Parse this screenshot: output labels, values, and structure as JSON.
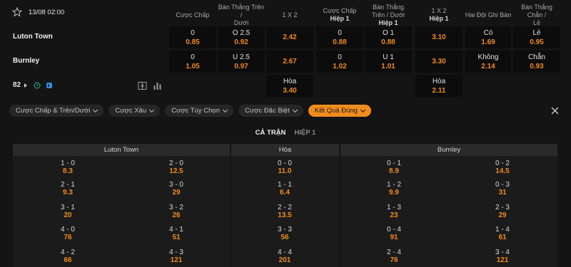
{
  "match": {
    "datetime": "13/08 02:00",
    "home_team": "Luton Town",
    "away_team": "Burnley",
    "more_markets_count": "82"
  },
  "columns": [
    {
      "line1": "Cược Chấp",
      "line2": ""
    },
    {
      "line1": "Bàn Thắng Trên /",
      "line2": "Dưới"
    },
    {
      "line1": "1 X 2",
      "line2": ""
    },
    {
      "line1": "Cược Chấp",
      "line2": "Hiệp 1"
    },
    {
      "line1": "Bàn Thắng Trên / Dưới",
      "line2": "Hiệp 1"
    },
    {
      "line1": "1 X 2",
      "line2": "Hiệp 1"
    },
    {
      "line1": "Hai Đội Ghi Bàn",
      "line2": ""
    },
    {
      "line1": "Bàn Thắng Chẵn /",
      "line2": "Lẻ"
    }
  ],
  "odds": {
    "r1": [
      {
        "l": "0",
        "v": "0.85"
      },
      {
        "l": "O 2.5",
        "v": "0.92"
      },
      {
        "l": "",
        "v": "2.42"
      },
      {
        "l": "0",
        "v": "0.88"
      },
      {
        "l": "O 1",
        "v": "0.88"
      },
      {
        "l": "",
        "v": "3.10"
      },
      {
        "l": "Có",
        "v": "1.69"
      },
      {
        "l": "Lẻ",
        "v": "0.95"
      }
    ],
    "r2": [
      {
        "l": "0",
        "v": "1.05"
      },
      {
        "l": "U 2.5",
        "v": "0.97"
      },
      {
        "l": "",
        "v": "2.67"
      },
      {
        "l": "0",
        "v": "1.02"
      },
      {
        "l": "U 1",
        "v": "1.01"
      },
      {
        "l": "",
        "v": "3.30"
      },
      {
        "l": "Không",
        "v": "2.14"
      },
      {
        "l": "Chẵn",
        "v": "0.93"
      }
    ],
    "r3": [
      {
        "l": "Hòa",
        "v": "3.40"
      },
      {
        "l": "Hòa",
        "v": "2.11"
      }
    ]
  },
  "filters": [
    {
      "label": "Cược Chấp & Trên/Dưới",
      "active": false
    },
    {
      "label": "Cược Xâu",
      "active": false
    },
    {
      "label": "Cược Tùy Chọn",
      "active": false
    },
    {
      "label": "Cược Đặc Biệt",
      "active": false
    },
    {
      "label": "Kết Quả Đúng",
      "active": true
    }
  ],
  "tabs": [
    {
      "label": "CẢ TRẬN",
      "active": true
    },
    {
      "label": "HIỆP 1",
      "active": false
    }
  ],
  "correct_score": {
    "headers": [
      "Luton Town",
      "Hòa",
      "Burnley"
    ],
    "home_left": [
      {
        "s": "1 - 0",
        "o": "8.3"
      },
      {
        "s": "2 - 1",
        "o": "9.3"
      },
      {
        "s": "3 - 1",
        "o": "20"
      },
      {
        "s": "4 - 0",
        "o": "76"
      },
      {
        "s": "4 - 2",
        "o": "66"
      }
    ],
    "home_right": [
      {
        "s": "2 - 0",
        "o": "12.5"
      },
      {
        "s": "3 - 0",
        "o": "29"
      },
      {
        "s": "3 - 2",
        "o": "26"
      },
      {
        "s": "4 - 1",
        "o": "51"
      },
      {
        "s": "4 - 3",
        "o": "121"
      }
    ],
    "draw": [
      {
        "s": "0 - 0",
        "o": "11.0"
      },
      {
        "s": "1 - 1",
        "o": "6.4"
      },
      {
        "s": "2 - 2",
        "o": "13.5"
      },
      {
        "s": "3 - 3",
        "o": "56"
      },
      {
        "s": "4 - 4",
        "o": "201"
      }
    ],
    "away_left": [
      {
        "s": "0 - 1",
        "o": "8.9"
      },
      {
        "s": "1 - 2",
        "o": "9.9"
      },
      {
        "s": "1 - 3",
        "o": "23"
      },
      {
        "s": "0 - 4",
        "o": "91"
      },
      {
        "s": "2 - 4",
        "o": "76"
      }
    ],
    "away_right": [
      {
        "s": "0 - 2",
        "o": "14.5"
      },
      {
        "s": "0 - 3",
        "o": "31"
      },
      {
        "s": "2 - 3",
        "o": "29"
      },
      {
        "s": "1 - 4",
        "o": "61"
      },
      {
        "s": "3 - 4",
        "o": "121"
      }
    ]
  },
  "colors": {
    "accent": "#f08c1e",
    "odds": "#f28a1e",
    "background": "#141414",
    "cell": "#0c0c0c"
  },
  "icons": [
    "star-icon",
    "play-triangle-icon",
    "clock-icon",
    "stats-icon",
    "field-icon",
    "bar-chart-icon",
    "close-icon",
    "chevron-down-icon"
  ]
}
